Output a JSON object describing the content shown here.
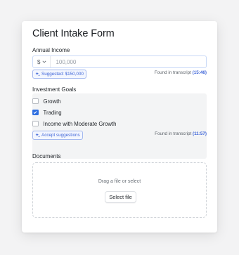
{
  "form": {
    "title": "Client Intake Form"
  },
  "income": {
    "label": "Annual Income",
    "currency_symbol": "$",
    "placeholder": "100,000",
    "suggestion_chip": "Suggested: $150,000",
    "found_text": "Found in transcript",
    "found_timestamp": "(15:46)"
  },
  "goals": {
    "label": "Investment Goals",
    "options": [
      {
        "label": "Growth",
        "checked": false
      },
      {
        "label": "Trading",
        "checked": true
      },
      {
        "label": "Income with Moderate Growth",
        "checked": false
      }
    ],
    "accept_chip": "Accept suggestions",
    "found_text": "Found in transcript",
    "found_timestamp": "(11:57)"
  },
  "documents": {
    "label": "Documents",
    "drop_text": "Drag a file or select",
    "select_button": "Select file"
  },
  "colors": {
    "accent": "#3d64d8",
    "checkbox_checked": "#2f6fe0",
    "panel_bg": "#f3f4f5",
    "page_bg": "#f3f3f4"
  },
  "icons": {
    "currency_dropdown": "chevron-down-icon",
    "suggestion": "sparkle-icon",
    "check": "checkmark-icon"
  }
}
